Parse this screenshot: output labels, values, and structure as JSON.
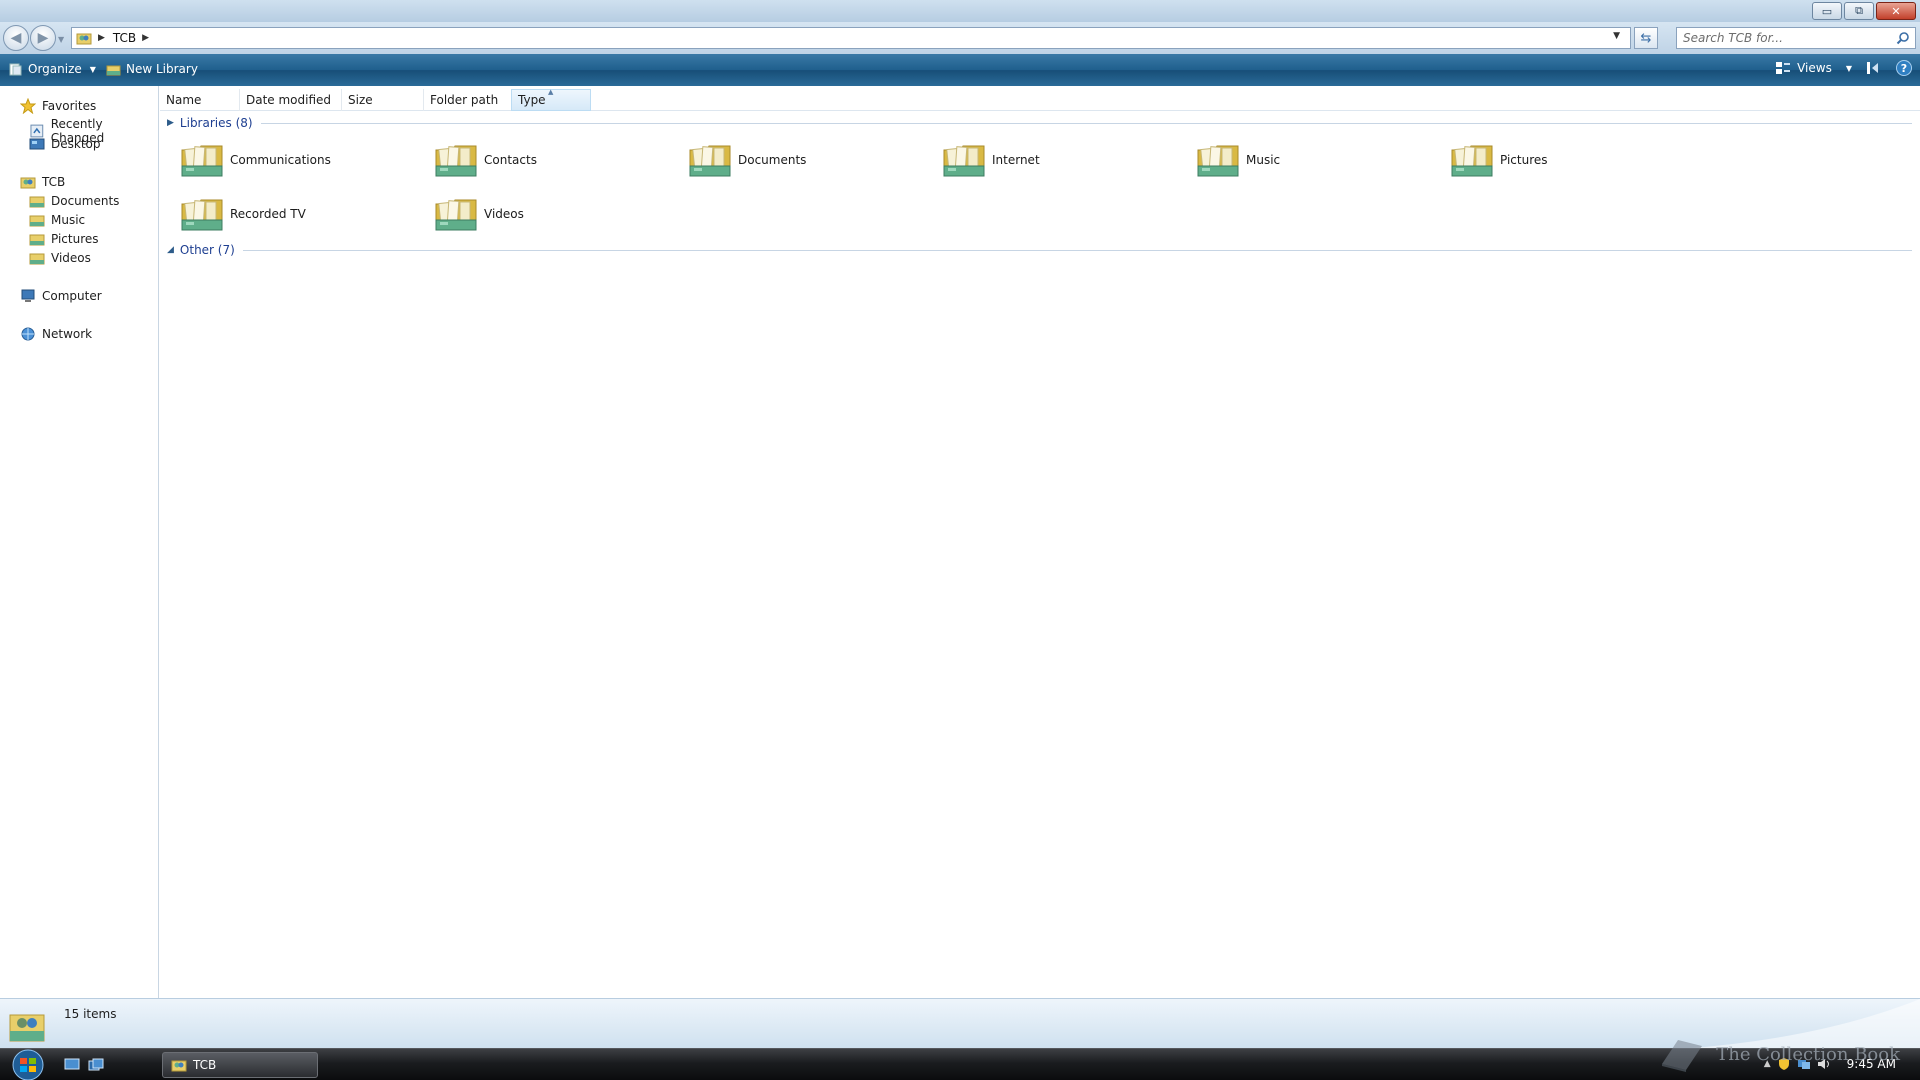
{
  "window": {
    "controls": {
      "minimize": "▭",
      "maximize": "⧉",
      "close": "✕"
    }
  },
  "address": {
    "path": "TCB",
    "search_placeholder": "Search TCB for..."
  },
  "toolbar": {
    "organize": "Organize",
    "new_library": "New Library",
    "views": "Views",
    "help": "?"
  },
  "nav": {
    "favorites": "Favorites",
    "recently_changed": "Recently Changed",
    "desktop": "Desktop",
    "user": "TCB",
    "documents": "Documents",
    "music": "Music",
    "pictures": "Pictures",
    "videos": "Videos",
    "computer": "Computer",
    "network": "Network"
  },
  "columns": {
    "name": "Name",
    "date_modified": "Date modified",
    "size": "Size",
    "folder_path": "Folder path",
    "type": "Type"
  },
  "groups": {
    "libraries": "Libraries (8)",
    "other": "Other (7)"
  },
  "libraries": [
    "Communications",
    "Contacts",
    "Documents",
    "Internet",
    "Music",
    "Pictures",
    "Recorded TV",
    "Videos"
  ],
  "status": {
    "item_count": "15 items"
  },
  "taskbar": {
    "window_button": "TCB",
    "clock": "9:45 AM",
    "watermark": "The Collection Book"
  },
  "colors": {
    "command_bar": "#1f5f8d",
    "group_title": "#1e3f91",
    "folder_yellow": "#e8cf6a",
    "library_green": "#5fae8a"
  }
}
